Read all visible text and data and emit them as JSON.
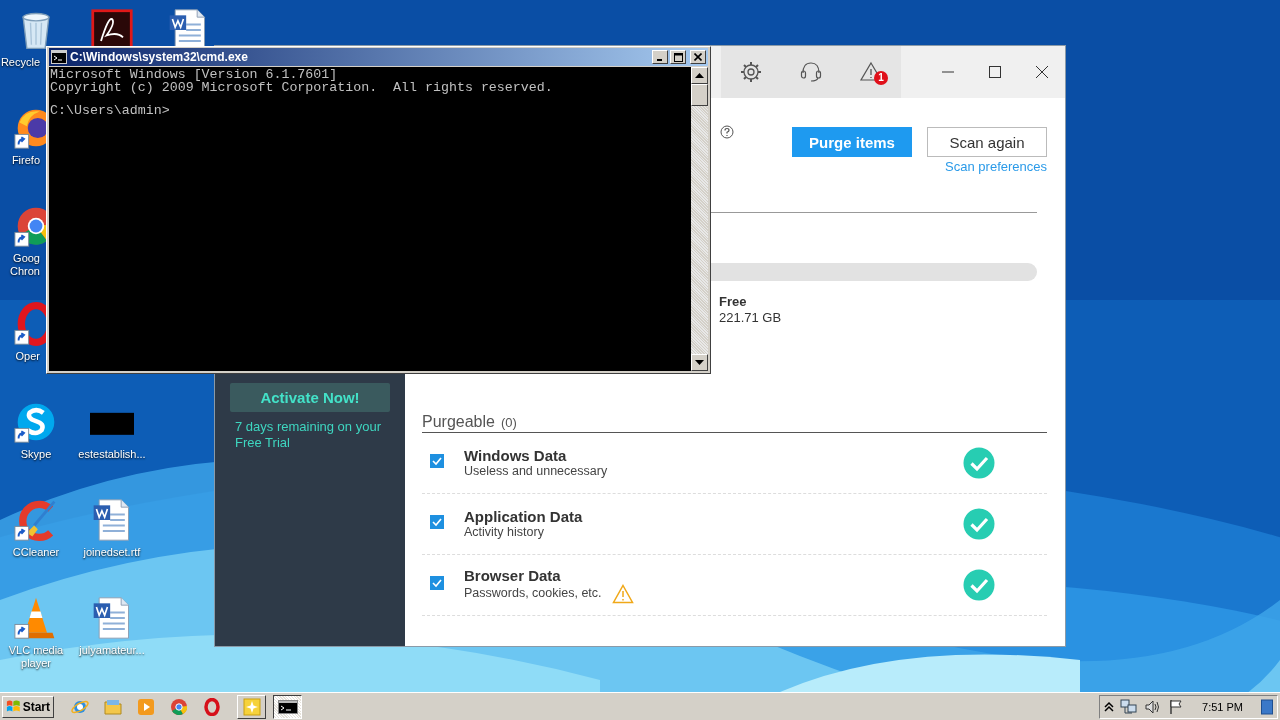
{
  "desktop": {
    "icons": [
      {
        "kind": "recycle",
        "label": "Recycle",
        "shortcut": false
      },
      {
        "kind": "pdf",
        "shortcut": false
      },
      {
        "kind": "word",
        "shortcut": false
      },
      {
        "kind": "firefox",
        "label": "Firefo",
        "shortcut": true
      },
      {
        "kind": "chrome",
        "label": "Goog\nChron",
        "shortcut": true
      },
      {
        "kind": "opera",
        "label": "Oper",
        "shortcut": true
      },
      {
        "kind": "skype",
        "label": "Skype",
        "shortcut": true
      },
      {
        "kind": "blank",
        "label": "estestablish...",
        "shortcut": false
      },
      {
        "kind": "ccleaner",
        "label": "CCleaner",
        "shortcut": true
      },
      {
        "kind": "word",
        "label": "joinedset.rtf",
        "shortcut": false
      },
      {
        "kind": "vlc",
        "label": "VLC media player",
        "shortcut": true
      },
      {
        "kind": "word",
        "label": "julyamateur...",
        "shortcut": false
      }
    ]
  },
  "console_window": {
    "title": "C:\\Windows\\system32\\cmd.exe",
    "output": [
      "Microsoft Windows [Version 6.1.7601]",
      "Copyright (c) 2009 Microsoft Corporation.  All rights reserved."
    ],
    "prompt": "C:\\Users\\admin>"
  },
  "cleaner_window": {
    "alerts_badge": "1",
    "purge_button": "Purge items",
    "scan_button": "Scan again",
    "scan_preferences_link": "Scan preferences",
    "activate_button": "Activate Now!",
    "trial_text": "7 days remaining on your Free Trial",
    "free_label": "Free",
    "free_value": "221.71 GB",
    "purgeable_title": "Purgeable",
    "purgeable_count": "(0)",
    "items": [
      {
        "title": "Windows Data",
        "subtitle": "Useless and unnecessary",
        "checked": true,
        "warning": false
      },
      {
        "title": "Application Data",
        "subtitle": "Activity history",
        "checked": true,
        "warning": false
      },
      {
        "title": "Browser Data",
        "subtitle": "Passwords, cookies, etc.",
        "checked": true,
        "warning": true
      }
    ]
  },
  "taskbar": {
    "start_label": "Start",
    "quick_launch": [
      {
        "kind": "ie"
      },
      {
        "kind": "folder"
      },
      {
        "kind": "media"
      },
      {
        "kind": "chrome"
      },
      {
        "kind": "opera"
      }
    ],
    "tasks": [
      {
        "kind": "app",
        "selected": false
      },
      {
        "kind": "console",
        "selected": true
      }
    ],
    "clock": "7:51 PM"
  }
}
